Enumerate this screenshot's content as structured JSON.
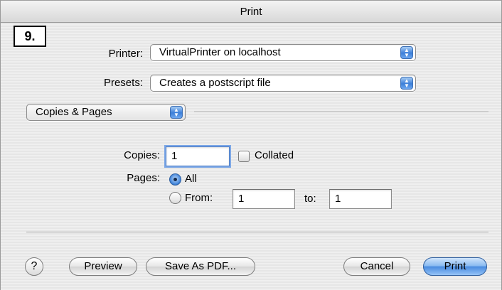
{
  "window": {
    "title": "Print"
  },
  "badge": "9.",
  "printer": {
    "label": "Printer:",
    "value": "VirtualPrinter on localhost"
  },
  "presets": {
    "label": "Presets:",
    "value": "Creates a postscript file"
  },
  "section": {
    "value": "Copies & Pages"
  },
  "copies": {
    "label": "Copies:",
    "value": "1",
    "collated_label": "Collated",
    "collated_checked": false
  },
  "pages": {
    "label": "Pages:",
    "all_label": "All",
    "all_selected": true,
    "from_label": "From:",
    "from_value": "1",
    "to_label": "to:",
    "to_value": "1"
  },
  "buttons": {
    "help": "?",
    "preview": "Preview",
    "save_pdf": "Save As PDF...",
    "cancel": "Cancel",
    "print": "Print"
  },
  "icons": {
    "popup_arrows": "▲▼"
  }
}
